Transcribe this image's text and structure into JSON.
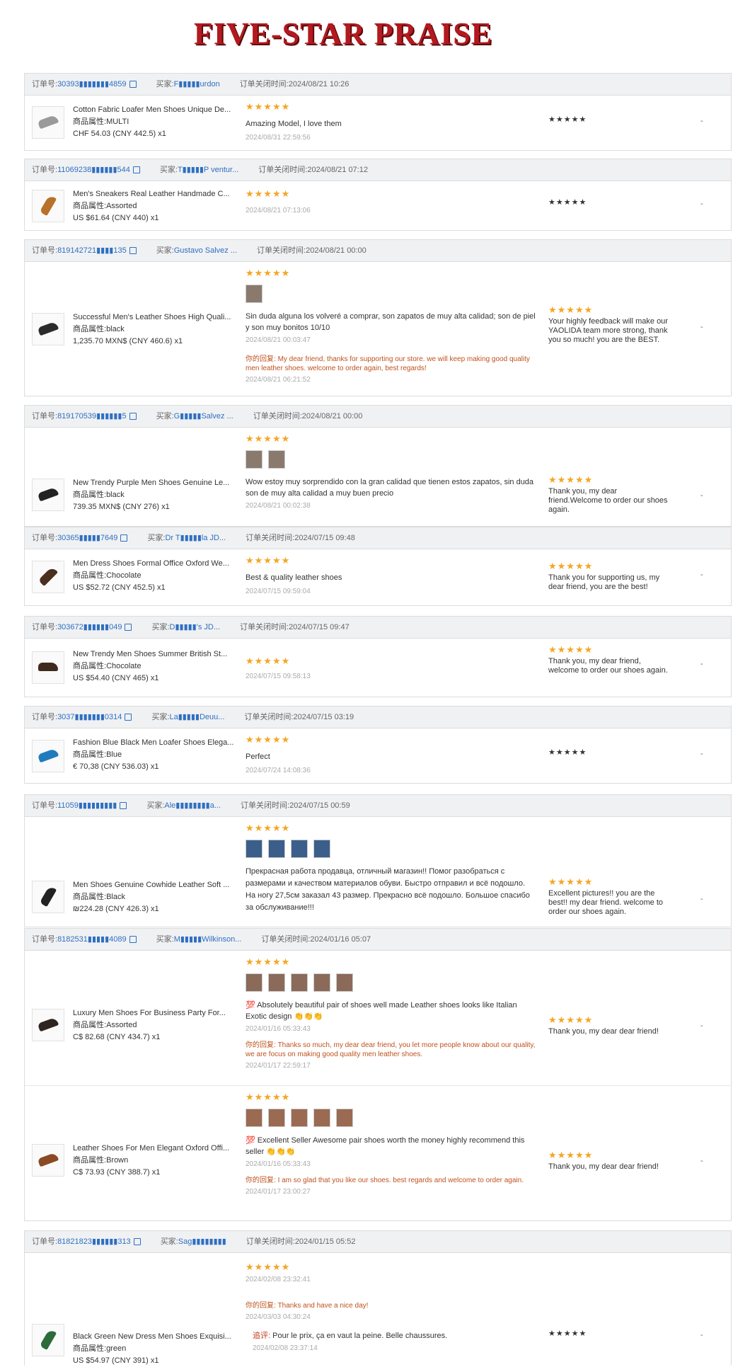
{
  "title": "FIVE-STAR PRAISE",
  "labels": {
    "order_no": "订单号:",
    "buyer": "买家:",
    "closed_time": "订单关闭时间:",
    "attr": "商品属性:",
    "reply": "你的回复:",
    "followup": "追评:",
    "dash": "-"
  },
  "stars": "★★★★★",
  "orders": [
    {
      "order_no": "30393▮▮▮▮▮▮▮4859",
      "buyer": "F▮▮▮▮▮urdon",
      "closed": "2024/08/21 10:26",
      "items": [
        {
          "name": "Cotton Fabric Loafer Men Shoes Unique De...",
          "attr": "MULTI",
          "price": "CHF 54.03 (CNY 442.5) x1",
          "review": "Amazing Model, I love them",
          "review_date": "2024/08/31 22:59:56",
          "response": ""
        }
      ]
    },
    {
      "order_no": "11069238▮▮▮▮▮▮544",
      "buyer": "T▮▮▮▮▮P ventur...",
      "closed": "2024/08/21 07:12",
      "items": [
        {
          "name": "Men's Sneakers Real Leather Handmade C...",
          "attr": "Assorted",
          "price": "US $61.64 (CNY 440) x1",
          "review": "",
          "review_date": "2024/08/21 07:13:06",
          "response": ""
        }
      ]
    },
    {
      "order_no": "819142721▮▮▮▮135",
      "buyer": "Gustavo Salvez ...",
      "closed": "2024/08/21 00:00",
      "items": [
        {
          "name": "Successful Men's Leather Shoes High Quali...",
          "attr": "black",
          "price": "1,235.70 MXN$ (CNY 460.6) x1",
          "review": "Sin duda alguna los volveré a comprar, son zapatos de muy alta calidad; son de piel y son muy bonitos 10/10",
          "review_date": "2024/08/21 00:03:47",
          "reply": "My dear friend, thanks for supporting our store. we will keep making good quality men leather shoes. welcome to order again, best regards!",
          "reply_date": "2024/08/21 06:21:52",
          "response": "Your highly feedback will make our YAOLIDA team more strong, thank you so much! you are the BEST."
        }
      ]
    },
    {
      "order_no": "819170539▮▮▮▮▮▮5",
      "buyer": "G▮▮▮▮▮Salvez ...",
      "closed": "2024/08/21 00:00",
      "items": [
        {
          "name": "New Trendy Purple Men Shoes Genuine Le...",
          "attr": "black",
          "price": "739.35 MXN$ (CNY 276) x1",
          "review": "Wow estoy muy sorprendido con la gran calidad que tienen estos zapatos, sin duda son de muy alta calidad a muy buen precio",
          "review_date": "2024/08/21 00:02:38",
          "response": "Thank you, my dear friend.Welcome to order our shoes again."
        }
      ]
    },
    {
      "order_no": "30365▮▮▮▮▮7649",
      "buyer": "Dr T▮▮▮▮▮la JD...",
      "closed": "2024/07/15 09:48",
      "items": [
        {
          "name": "Men Dress Shoes Formal Office Oxford We...",
          "attr": "Chocolate",
          "price": "US $52.72 (CNY 452.5) x1",
          "review": "Best & quality leather shoes",
          "review_date": "2024/07/15 09:59:04",
          "response": "Thank you for supporting us, my dear friend, you are the best!"
        }
      ]
    },
    {
      "order_no": "303672▮▮▮▮▮▮049",
      "buyer": "D▮▮▮▮▮'s JD...",
      "closed": "2024/07/15 09:47",
      "items": [
        {
          "name": "New Trendy Men Shoes Summer British St...",
          "attr": "Chocolate",
          "price": "US $54.40 (CNY 465) x1",
          "review": "",
          "review_date": "2024/07/15 09:58:13",
          "response": "Thank you, my dear friend, welcome to order our shoes again."
        }
      ]
    },
    {
      "order_no": "3037▮▮▮▮▮▮▮0314",
      "buyer": "La▮▮▮▮▮Deuu...",
      "closed": "2024/07/15 03:19",
      "items": [
        {
          "name": "Fashion Blue Black Men Loafer Shoes Elega...",
          "attr": "Blue",
          "price": "€ 70,38 (CNY 536.03) x1",
          "review": "Perfect",
          "review_date": "2024/07/24 14:08:36",
          "response": ""
        }
      ]
    },
    {
      "order_no": "11059▮▮▮▮▮▮▮▮▮",
      "buyer": "Ale▮▮▮▮▮▮▮▮a...",
      "closed": "2024/07/15 00:59",
      "items": [
        {
          "name": "Men Shoes Genuine Cowhide Leather Soft ...",
          "attr": "Black",
          "price": "₪224.28 (CNY 426.3) x1",
          "review": "Прекрасная работа продавца, отличный магазин!! Помог разобраться с размерами и качеством материалов обуви. Быстро отправил и всё подошло. На ногу 27,5см заказал 43 размер. Прекрасно всё подошло. Большое спасибо за обслуживание!!!",
          "review_date": "",
          "response": "Excellent pictures!! you are the best!! my dear friend. welcome to order our shoes again."
        }
      ]
    },
    {
      "order_no": "8182531▮▮▮▮▮4089",
      "buyer": "M▮▮▮▮▮Wilkinson...",
      "closed": "2024/01/16 05:07",
      "items": [
        {
          "name": "Luxury Men Shoes For Business Party For...",
          "attr": "Assorted",
          "price": "C$ 82.68 (CNY 434.7) x1",
          "review": "💯 Absolutely beautiful pair of shoes well made Leather shoes looks like Italian Exotic design 👏👏👏",
          "review_date": "2024/01/16 05:33:43",
          "reply": "Thanks so much, my dear dear friend, you let more people know about our quality, we are focus on making good quality men leather shoes.",
          "reply_date": "2024/01/17 22:59:17",
          "response": "Thank you, my dear dear friend!"
        },
        {
          "name": "Leather Shoes For Men Elegant Oxford Offi...",
          "attr": "Brown",
          "price": "C$ 73.93 (CNY 388.7) x1",
          "review": "💯 Excellent Seller Awesome pair shoes worth the money highly recommend this seller 👏👏👏",
          "review_date": "2024/01/16 05:33:43",
          "reply": "I am so glad that you like our shoes. best regards and welcome to order again.",
          "reply_date": "2024/01/17 23:00:27",
          "response": "Thank you, my dear dear friend!"
        }
      ]
    },
    {
      "order_no": "81821823▮▮▮▮▮▮313",
      "buyer": "Sag▮▮▮▮▮▮▮▮",
      "closed": "2024/01/15 05:52",
      "items": [
        {
          "name": "Black Green New Dress Men Shoes Exquisi...",
          "attr": "green",
          "price": "US $54.97 (CNY 391) x1",
          "review": "",
          "review_date": "2024/02/08 23:32:41",
          "reply": "Thanks and have a nice day!",
          "reply_date": "2024/03/03 04:30:24",
          "followup": "Pour le prix, ça en vaut la peine. Belle chaussures.",
          "followup_date": "2024/02/08 23:37:14",
          "response": ""
        }
      ]
    }
  ],
  "colors": {
    "title": "#b3191f",
    "link": "#2f6fc1",
    "star": "#f4a623",
    "reply": "#c0521d",
    "header_bg": "#f0f1f3"
  }
}
